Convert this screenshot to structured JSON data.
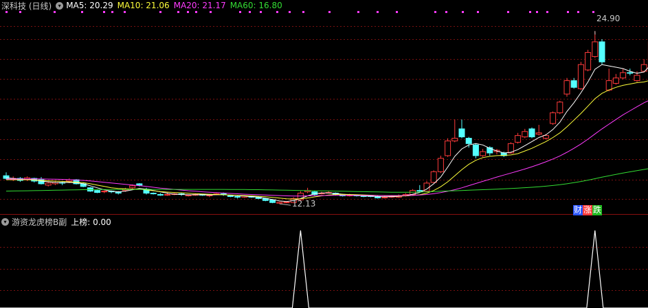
{
  "main_header": {
    "stock": "深科技 (日线)",
    "ma5": "MA5: 20.29",
    "ma10": "MA10: 21.06",
    "ma20": "MA20: 21.17",
    "ma60": "MA60: 16.80"
  },
  "sub_header": {
    "indicator": "游资龙虎榜B副",
    "value": "上榜: 0.00"
  },
  "annotations": {
    "high": "24.90",
    "low": "12.13"
  },
  "finance_tag": {
    "c1": "财",
    "c2": "涨",
    "c3": "跌"
  },
  "icons": {
    "collapse_main": "chevron-down-icon",
    "collapse_sub": "chevron-down-icon"
  },
  "colors": {
    "background": "#000000",
    "up": "#ff3b3b",
    "down": "#54ffff",
    "ma5": "#ffffff",
    "ma10": "#ffff3a",
    "ma20": "#ff3bff",
    "ma60": "#33dd33",
    "grid": "#7a1010",
    "header_text": "#c0c0c0"
  },
  "chart_data": [
    {
      "type": "candlestick",
      "title": "深科技 (日线)",
      "ylim": [
        11.6,
        26.3
      ],
      "high_label": 24.9,
      "low_label": 12.13,
      "candles": [
        [
          14.1,
          13.9,
          14.35,
          13.8
        ],
        [
          13.8,
          13.9,
          14.05,
          13.7
        ],
        [
          13.9,
          13.75,
          14.0,
          13.65
        ],
        [
          13.8,
          13.95,
          14.05,
          13.7
        ],
        [
          13.9,
          13.7,
          13.95,
          13.6
        ],
        [
          13.8,
          13.5,
          14.0,
          13.45
        ],
        [
          13.4,
          13.55,
          13.65,
          13.3
        ],
        [
          13.5,
          13.6,
          13.7,
          13.4
        ],
        [
          13.6,
          13.55,
          13.65,
          13.4
        ],
        [
          13.7,
          13.8,
          13.9,
          13.55
        ],
        [
          13.8,
          13.5,
          13.85,
          13.45
        ],
        [
          13.5,
          13.3,
          13.6,
          13.25
        ],
        [
          13.2,
          12.95,
          13.25,
          12.9
        ],
        [
          13.0,
          12.85,
          13.05,
          12.8
        ],
        [
          12.9,
          12.95,
          13.0,
          12.8
        ],
        [
          12.95,
          12.9,
          13.0,
          12.8
        ],
        [
          12.9,
          12.8,
          12.95,
          12.7
        ],
        [
          13.0,
          13.1,
          13.2,
          12.9
        ],
        [
          13.2,
          13.35,
          13.45,
          13.05
        ],
        [
          13.5,
          13.4,
          13.55,
          13.3
        ],
        [
          13.1,
          12.8,
          13.2,
          12.7
        ],
        [
          12.8,
          12.78,
          12.85,
          12.7
        ],
        [
          12.7,
          12.65,
          12.8,
          12.6
        ],
        [
          12.65,
          12.7,
          12.85,
          12.6
        ],
        [
          12.7,
          12.75,
          12.8,
          12.65
        ],
        [
          12.75,
          12.7,
          12.85,
          12.6
        ],
        [
          12.6,
          12.65,
          12.7,
          12.55
        ],
        [
          12.65,
          12.7,
          12.75,
          12.6
        ],
        [
          12.7,
          12.65,
          12.75,
          12.6
        ],
        [
          12.6,
          12.65,
          12.7,
          12.5
        ],
        [
          12.7,
          12.75,
          12.8,
          12.65
        ],
        [
          12.75,
          12.7,
          12.85,
          12.6
        ],
        [
          12.6,
          12.55,
          12.65,
          12.5
        ],
        [
          12.55,
          12.5,
          12.6,
          12.4
        ],
        [
          12.5,
          12.6,
          12.65,
          12.45
        ],
        [
          12.55,
          12.5,
          12.6,
          12.45
        ],
        [
          12.5,
          12.4,
          12.55,
          12.35
        ],
        [
          12.4,
          12.25,
          12.45,
          12.2
        ],
        [
          12.3,
          12.1,
          12.35,
          12.05
        ],
        [
          12.05,
          12.12,
          12.15,
          12.0
        ],
        [
          12.1,
          12.13,
          12.2,
          12.05
        ],
        [
          12.1,
          12.4,
          12.5,
          12.05
        ],
        [
          12.3,
          12.8,
          12.95,
          12.25
        ],
        [
          12.9,
          13.0,
          13.2,
          12.8
        ],
        [
          12.9,
          12.7,
          12.95,
          12.6
        ],
        [
          12.75,
          12.8,
          12.9,
          12.7
        ],
        [
          12.85,
          12.85,
          12.95,
          12.8
        ],
        [
          12.8,
          12.7,
          12.85,
          12.65
        ],
        [
          12.7,
          12.6,
          12.75,
          12.55
        ],
        [
          12.6,
          12.65,
          12.75,
          12.55
        ],
        [
          12.65,
          12.6,
          12.7,
          12.55
        ],
        [
          12.6,
          12.55,
          12.65,
          12.5
        ],
        [
          12.6,
          12.55,
          12.65,
          12.5
        ],
        [
          12.55,
          12.45,
          12.6,
          12.4
        ],
        [
          12.45,
          12.5,
          12.6,
          12.4
        ],
        [
          12.5,
          12.55,
          12.65,
          12.45
        ],
        [
          12.5,
          12.6,
          12.7,
          12.45
        ],
        [
          12.6,
          12.7,
          12.8,
          12.55
        ],
        [
          12.7,
          13.0,
          13.1,
          12.65
        ],
        [
          13.0,
          12.95,
          13.4,
          12.9
        ],
        [
          12.95,
          13.55,
          13.7,
          12.9
        ],
        [
          13.6,
          14.4,
          14.5,
          13.55
        ],
        [
          14.4,
          15.4,
          15.6,
          14.3
        ],
        [
          15.6,
          16.7,
          16.9,
          15.5
        ],
        [
          16.7,
          16.9,
          18.3,
          16.6
        ],
        [
          17.6,
          17.0,
          18.3,
          16.9
        ],
        [
          16.9,
          16.5,
          17.0,
          16.2
        ],
        [
          16.4,
          15.6,
          16.5,
          15.4
        ],
        [
          15.6,
          15.9,
          16.1,
          15.5
        ],
        [
          16.2,
          15.8,
          16.3,
          15.6
        ],
        [
          15.9,
          16.0,
          16.1,
          15.7
        ],
        [
          15.8,
          15.6,
          15.9,
          15.5
        ],
        [
          15.8,
          16.5,
          16.6,
          15.75
        ],
        [
          16.6,
          17.1,
          17.3,
          16.5
        ],
        [
          17.0,
          17.4,
          17.6,
          16.9
        ],
        [
          17.6,
          17.0,
          17.7,
          16.9
        ],
        [
          17.2,
          17.3,
          17.9,
          17.1
        ],
        [
          16.9,
          17.1,
          17.2,
          16.8
        ],
        [
          18.0,
          18.8,
          18.9,
          17.9
        ],
        [
          18.8,
          19.6,
          19.7,
          18.7
        ],
        [
          20.2,
          21.2,
          21.4,
          20.0
        ],
        [
          21.2,
          20.7,
          21.4,
          20.6
        ],
        [
          20.6,
          22.4,
          22.6,
          20.5
        ],
        [
          22.0,
          23.3,
          23.5,
          21.9
        ],
        [
          23.0,
          24.1,
          24.9,
          22.9
        ],
        [
          24.1,
          22.6,
          24.3,
          22.4
        ],
        [
          20.5,
          21.2,
          22.1,
          20.4
        ],
        [
          21.0,
          21.4,
          21.7,
          20.9
        ],
        [
          21.4,
          21.8,
          22.1,
          21.3
        ],
        [
          21.8,
          21.75,
          22.1,
          21.6
        ],
        [
          21.2,
          21.6,
          21.9,
          21.1
        ],
        [
          21.9,
          22.4,
          22.8,
          21.8
        ],
        [
          22.5,
          24.1,
          24.3,
          22.4
        ],
        [
          24.1,
          22.8,
          24.5,
          22.6
        ]
      ],
      "series": [
        {
          "name": "MA5",
          "values": [
            13.95,
            13.9,
            13.85,
            13.85,
            13.8,
            13.7,
            13.65,
            13.6,
            13.6,
            13.6,
            13.58,
            13.5,
            13.35,
            13.2,
            13.05,
            12.95,
            12.9,
            12.95,
            13.05,
            13.15,
            13.1,
            13.0,
            12.9,
            12.8,
            12.72,
            12.7,
            12.68,
            12.68,
            12.68,
            12.67,
            12.68,
            12.68,
            12.65,
            12.62,
            12.58,
            12.55,
            12.5,
            12.42,
            12.32,
            12.22,
            12.18,
            12.25,
            12.4,
            12.6,
            12.75,
            12.82,
            12.82,
            12.78,
            12.72,
            12.68,
            12.64,
            12.6,
            12.58,
            12.55,
            12.53,
            12.54,
            12.56,
            12.62,
            12.72,
            12.85,
            13.1,
            13.5,
            14.0,
            14.75,
            15.55,
            16.1,
            16.4,
            16.5,
            16.4,
            16.15,
            15.95,
            15.8,
            15.85,
            16.05,
            16.35,
            16.65,
            16.95,
            17.15,
            17.55,
            18.1,
            18.9,
            19.55,
            20.3,
            21.1,
            22.05,
            22.4,
            22.3,
            22.2,
            22.1,
            21.9,
            21.75,
            21.85,
            22.4,
            22.55
          ]
        },
        {
          "name": "MA10",
          "values": [
            13.8,
            13.8,
            13.8,
            13.8,
            13.78,
            13.75,
            13.72,
            13.7,
            13.68,
            13.65,
            13.62,
            13.58,
            13.5,
            13.4,
            13.3,
            13.2,
            13.15,
            13.12,
            13.1,
            13.1,
            13.05,
            12.98,
            12.92,
            12.88,
            12.85,
            12.83,
            12.8,
            12.77,
            12.74,
            12.72,
            12.7,
            12.68,
            12.66,
            12.64,
            12.62,
            12.6,
            12.57,
            12.53,
            12.48,
            12.43,
            12.38,
            12.36,
            12.38,
            12.44,
            12.52,
            12.6,
            12.66,
            12.7,
            12.71,
            12.7,
            12.69,
            12.67,
            12.65,
            12.63,
            12.61,
            12.6,
            12.59,
            12.6,
            12.63,
            12.68,
            12.8,
            13.0,
            13.28,
            13.65,
            14.1,
            14.55,
            14.95,
            15.25,
            15.45,
            15.55,
            15.6,
            15.62,
            15.65,
            15.75,
            15.95,
            16.15,
            16.4,
            16.65,
            16.95,
            17.3,
            17.75,
            18.25,
            18.75,
            19.3,
            19.85,
            20.25,
            20.5,
            20.7,
            20.85,
            20.95,
            21.05,
            21.1,
            21.25,
            21.4
          ]
        },
        {
          "name": "MA20",
          "values": [
            13.85,
            13.85,
            13.86,
            13.86,
            13.87,
            13.86,
            13.85,
            13.84,
            13.83,
            13.81,
            13.78,
            13.75,
            13.71,
            13.66,
            13.61,
            13.56,
            13.51,
            13.46,
            13.41,
            13.36,
            13.3,
            13.24,
            13.18,
            13.13,
            13.08,
            13.03,
            12.98,
            12.94,
            12.9,
            12.87,
            12.84,
            12.81,
            12.78,
            12.75,
            12.72,
            12.7,
            12.68,
            12.66,
            12.64,
            12.62,
            12.6,
            12.59,
            12.59,
            12.6,
            12.61,
            12.62,
            12.63,
            12.64,
            12.64,
            12.64,
            12.64,
            12.63,
            12.63,
            12.62,
            12.62,
            12.62,
            12.62,
            12.63,
            12.64,
            12.66,
            12.7,
            12.76,
            12.84,
            12.94,
            13.06,
            13.2,
            13.36,
            13.52,
            13.68,
            13.84,
            14.0,
            14.15,
            14.3,
            14.45,
            14.6,
            14.77,
            14.95,
            15.14,
            15.35,
            15.58,
            15.85,
            16.15,
            16.47,
            16.83,
            17.22,
            17.6,
            17.95,
            18.3,
            18.65,
            18.95,
            19.25,
            19.55,
            19.8,
            20.05
          ]
        },
        {
          "name": "MA60",
          "values": [
            12.95,
            12.96,
            12.97,
            12.98,
            12.99,
            13.0,
            13.01,
            13.02,
            13.03,
            13.04,
            13.05,
            13.06,
            13.06,
            13.07,
            13.07,
            13.07,
            13.07,
            13.08,
            13.08,
            13.08,
            13.08,
            13.08,
            13.08,
            13.08,
            13.08,
            13.08,
            13.08,
            13.08,
            13.08,
            13.08,
            13.08,
            13.08,
            13.07,
            13.07,
            13.07,
            13.06,
            13.06,
            13.05,
            13.04,
            13.03,
            13.02,
            13.01,
            13.0,
            12.99,
            12.98,
            12.97,
            12.96,
            12.95,
            12.94,
            12.93,
            12.92,
            12.91,
            12.9,
            12.89,
            12.88,
            12.87,
            12.87,
            12.87,
            12.87,
            12.88,
            12.9,
            12.92,
            12.94,
            12.96,
            12.98,
            13.0,
            13.02,
            13.04,
            13.06,
            13.08,
            13.1,
            13.12,
            13.15,
            13.18,
            13.21,
            13.24,
            13.28,
            13.32,
            13.37,
            13.43,
            13.5,
            13.58,
            13.67,
            13.77,
            13.88,
            13.99,
            14.1,
            14.2,
            14.3,
            14.39,
            14.48,
            14.57,
            14.66,
            14.75
          ]
        }
      ]
    },
    {
      "type": "line",
      "title": "游资龙虎榜B副",
      "series": [
        {
          "name": "上榜",
          "values": [
            0,
            0,
            0,
            0,
            0,
            0,
            0,
            0,
            0,
            0,
            0,
            0,
            0,
            0,
            0,
            0,
            0,
            0,
            0,
            0,
            0,
            0,
            0,
            0,
            0,
            0,
            0,
            0,
            0,
            0,
            0,
            0,
            0,
            0,
            0,
            0,
            0,
            0,
            0,
            0,
            0,
            0,
            1,
            0,
            0,
            0,
            0,
            0,
            0,
            0,
            0,
            0,
            0,
            0,
            0,
            0,
            0,
            0,
            0,
            0,
            0,
            0,
            0,
            0,
            0,
            0,
            0,
            0,
            0,
            0,
            0,
            0,
            0,
            0,
            0,
            0,
            0,
            0,
            0,
            0,
            0,
            0,
            0,
            0,
            1,
            0,
            0,
            0,
            0,
            0,
            0,
            0,
            0,
            0
          ]
        }
      ]
    }
  ]
}
